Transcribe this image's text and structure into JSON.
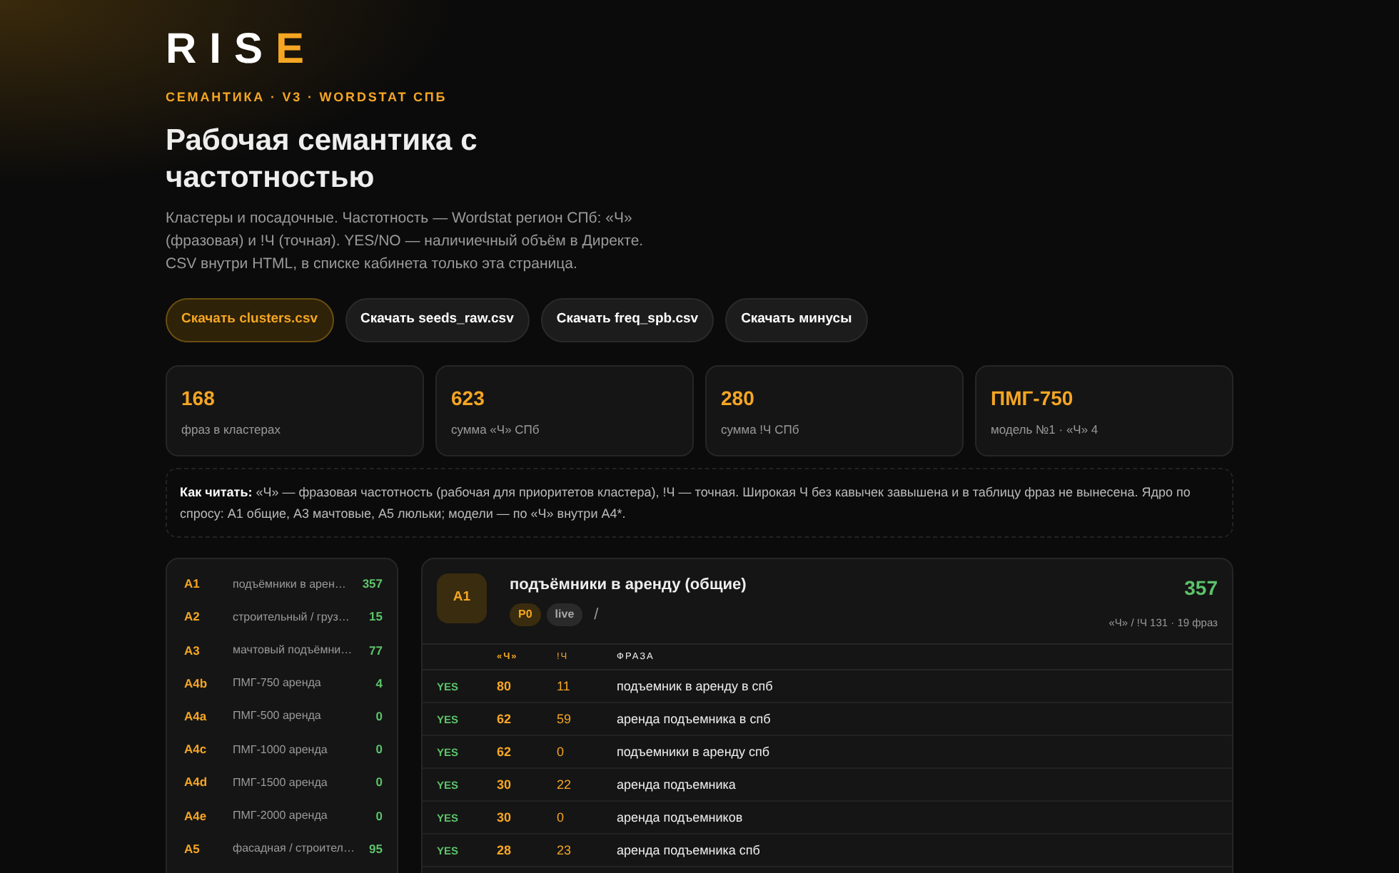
{
  "brand": {
    "main": "RIS",
    "accent": "E"
  },
  "eyebrow": "СЕМАНТИКА · V3 · WORDSTAT СПБ",
  "title": "Рабочая семантика с частотностью",
  "lead": "Кластеры и посадочные. Частотность — Wordstat регион СПб: «Ч» (фразовая) и !Ч (точная). YES/NO — наличиечный объём в Директе. CSV внутри HTML, в списке кабинета только эта страница.",
  "buttons": [
    {
      "label": "Скачать clusters.csv",
      "primary": true
    },
    {
      "label": "Скачать seeds_raw.csv",
      "primary": false
    },
    {
      "label": "Скачать freq_spb.csv",
      "primary": false
    },
    {
      "label": "Скачать минусы",
      "primary": false
    }
  ],
  "stats": [
    {
      "value": "168",
      "label": "фраз в кластерах"
    },
    {
      "value": "623",
      "label": "сумма «Ч» СПб"
    },
    {
      "value": "280",
      "label": "сумма !Ч СПб"
    },
    {
      "value": "ПМГ-750",
      "label": "модель №1 · «Ч» 4"
    }
  ],
  "note": "**Как читать:** «Ч» — фразовая частотность (рабочая для приоритетов кластера), !Ч — точная. Широкая Ч без кавычек завышена и в таблицу фраз не вынесена. Ядро по спросу: A1 общие, A3 мачтовые, A5 люльки; модели — по «Ч» внутри A4*.",
  "sidebar": {
    "items": [
      {
        "code": "A1",
        "name": "подъёмники в арен…",
        "count": "357"
      },
      {
        "code": "A2",
        "name": "строительный / груз…",
        "count": "15"
      },
      {
        "code": "A3",
        "name": "мачтовый подъёмни…",
        "count": "77"
      },
      {
        "code": "A4b",
        "name": "ПМГ-750 аренда",
        "count": "4"
      },
      {
        "code": "A4a",
        "name": "ПМГ-500 аренда",
        "count": "0"
      },
      {
        "code": "A4c",
        "name": "ПМГ-1000 аренда",
        "count": "0"
      },
      {
        "code": "A4d",
        "name": "ПМГ-1500 аренда",
        "count": "0"
      },
      {
        "code": "A4e",
        "name": "ПМГ-2000 аренда",
        "count": "0"
      },
      {
        "code": "A5",
        "name": "фасадная / строител…",
        "count": "95"
      }
    ]
  },
  "cluster": {
    "code": "A1",
    "title": "подъёмники в аренду (общие)",
    "tags": [
      "P0",
      "live"
    ],
    "separator": "/",
    "total": "357",
    "summary": "«Ч» / !Ч 131 · 19 фраз",
    "table": {
      "columns": [
        "«Ч»",
        "!Ч",
        "ФРАЗА"
      ],
      "rows": [
        {
          "status": "YES",
          "freq": "80",
          "exact": "11",
          "phrase": "подъемник в аренду в спб"
        },
        {
          "status": "YES",
          "freq": "62",
          "exact": "59",
          "phrase": "аренда подъемника в спб"
        },
        {
          "status": "YES",
          "freq": "62",
          "exact": "0",
          "phrase": "подъемники в аренду спб"
        },
        {
          "status": "YES",
          "freq": "30",
          "exact": "22",
          "phrase": "аренда подъемника"
        },
        {
          "status": "YES",
          "freq": "30",
          "exact": "0",
          "phrase": "аренда подъемников"
        },
        {
          "status": "YES",
          "freq": "28",
          "exact": "23",
          "phrase": "аренда подъемника спб"
        }
      ]
    }
  }
}
